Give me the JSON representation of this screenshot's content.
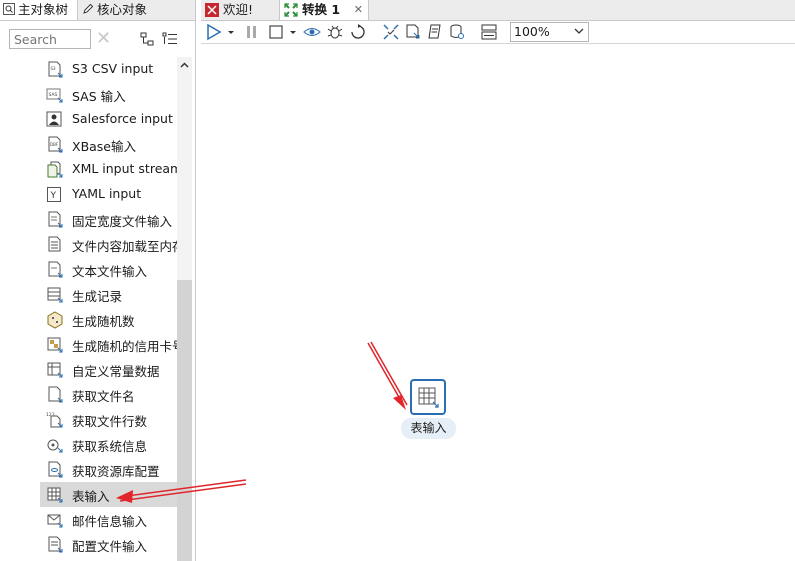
{
  "left_panel": {
    "tabs": [
      {
        "label": "主对象树",
        "icon": "search-icon"
      },
      {
        "label": "核心对象",
        "icon": "pencil-icon"
      }
    ],
    "search": {
      "placeholder": "Search",
      "value": ""
    },
    "items": [
      {
        "label": "S3 CSV input",
        "icon": "file-input-icon"
      },
      {
        "label": "SAS 输入",
        "icon": "sas-icon"
      },
      {
        "label": "Salesforce input",
        "icon": "salesforce-icon"
      },
      {
        "label": "XBase输入",
        "icon": "dbf-file-icon"
      },
      {
        "label": "XML input stream",
        "icon": "xml-file-icon"
      },
      {
        "label": "YAML input",
        "icon": "yaml-icon"
      },
      {
        "label": "固定宽度文件输入",
        "icon": "fixed-width-file-icon"
      },
      {
        "label": "文件内容加载至内存",
        "icon": "file-load-icon"
      },
      {
        "label": "文本文件输入",
        "icon": "text-file-icon"
      },
      {
        "label": "生成记录",
        "icon": "generate-rows-icon"
      },
      {
        "label": "生成随机数",
        "icon": "random-icon"
      },
      {
        "label": "生成随机的信用卡号",
        "icon": "credit-card-icon"
      },
      {
        "label": "自定义常量数据",
        "icon": "constant-grid-icon"
      },
      {
        "label": "获取文件名",
        "icon": "filename-icon"
      },
      {
        "label": "获取文件行数",
        "icon": "row-count-icon"
      },
      {
        "label": "获取系统信息",
        "icon": "system-info-icon"
      },
      {
        "label": "获取资源库配置",
        "icon": "repository-icon"
      },
      {
        "label": "表输入",
        "icon": "table-input-icon",
        "selected": true
      },
      {
        "label": "邮件信息输入",
        "icon": "mail-icon"
      },
      {
        "label": "配置文件输入",
        "icon": "properties-file-icon"
      }
    ]
  },
  "editor": {
    "tabs": [
      {
        "label": "欢迎!",
        "icon": "welcome-icon"
      },
      {
        "label": "转换 1",
        "icon": "transformation-icon",
        "active": true
      }
    ],
    "zoom": "100%",
    "canvas_step": {
      "label": "表输入",
      "icon": "table-input-icon"
    }
  },
  "colors": {
    "accent": "#2a6db0",
    "annotation_arrow": "#e0262b",
    "selection": "#d9d9d9"
  }
}
